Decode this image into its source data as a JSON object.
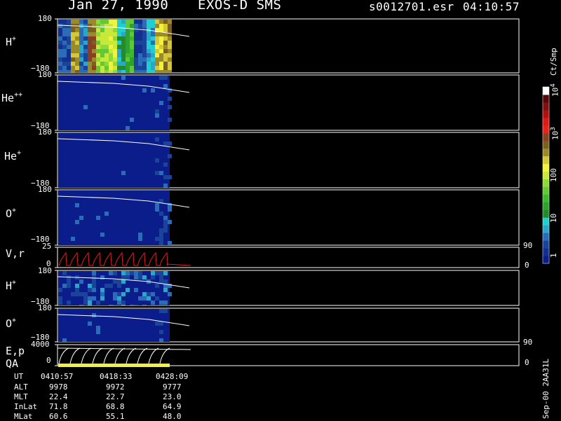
{
  "header": {
    "date": "Jan 27, 1990",
    "instrument": "EXOS-D SMS",
    "file": "s0012701.esr",
    "time": "04:10:57"
  },
  "colorbar": {
    "unit": "Ct/Smp",
    "labels": [
      "1",
      "10",
      "100",
      "10",
      "10"
    ],
    "exponents": [
      "3",
      "4"
    ],
    "colors": [
      "#0a1d8a",
      "#12308f",
      "#1a4499",
      "#2a6cb8",
      "#2aa6c8",
      "#1fcfcf",
      "#238b2a",
      "#2fa12f",
      "#3fb830",
      "#63c835",
      "#8fd83a",
      "#c8e83a",
      "#f2f23a",
      "#d4c83a",
      "#9a8a2a",
      "#7a6020",
      "#8a4020",
      "#e8241a",
      "#e01818",
      "#b01010",
      "#801010",
      "#560808",
      "#ffffff"
    ]
  },
  "panels": [
    {
      "label": "H",
      "charge": "+",
      "ymax": "180",
      "ymin": "−180"
    },
    {
      "label": "He",
      "charge": "++",
      "ymax": "180",
      "ymin": "−180"
    },
    {
      "label": "He",
      "charge": "+",
      "ymax": "180",
      "ymin": "−180"
    },
    {
      "label": "O",
      "charge": "+",
      "ymax": "180",
      "ymin": "−180"
    },
    {
      "label": "V,r",
      "charge": "",
      "ymax": "25",
      "ymin": "0",
      "rmax": "90",
      "rmin": "0"
    },
    {
      "label": "H",
      "charge": "+",
      "ymax": "180",
      "ymin": "−180"
    },
    {
      "label": "O",
      "charge": "+",
      "ymax": "180",
      "ymin": "−180"
    },
    {
      "label": "E,p",
      "charge": "",
      "ymax": "4000",
      "ymin": "0",
      "rmax": "90",
      "rmin": "0"
    }
  ],
  "qa_label": "QA",
  "footer": {
    "rows": [
      {
        "name": "UT",
        "values": [
          "0410:57",
          "0418:33",
          "0428:09"
        ]
      },
      {
        "name": "ALT",
        "values": [
          "9978",
          "9972",
          "9777"
        ]
      },
      {
        "name": "MLT",
        "values": [
          "22.4",
          "22.7",
          "23.0"
        ]
      },
      {
        "name": "InLat",
        "values": [
          "71.8",
          "68.8",
          "64.9"
        ]
      },
      {
        "name": "MLat",
        "values": [
          "60.6",
          "55.1",
          "48.0"
        ]
      }
    ]
  },
  "side_note": "Sep-00 2AA31L",
  "chart_data": {
    "type": "heatmap",
    "title": "Jan 27, 1990   EXOS-D SMS",
    "x_ticks": [
      "0410:57",
      "0418:33",
      "0428:09"
    ],
    "panels": [
      {
        "label": "H+",
        "ylim": [
          -180,
          180
        ],
        "dominant_counts": "10-100",
        "color_levels": [
          2,
          14,
          3,
          15,
          10,
          11,
          5,
          8,
          2,
          4,
          13,
          14
        ]
      },
      {
        "label": "He++",
        "ylim": [
          -180,
          180
        ],
        "dominant_counts": "1"
      },
      {
        "label": "He+",
        "ylim": [
          -180,
          180
        ],
        "dominant_counts": "1"
      },
      {
        "label": "O+",
        "ylim": [
          -180,
          180
        ],
        "dominant_counts": "1"
      },
      {
        "label": "V,r",
        "ylim": [
          0,
          25
        ],
        "right_ylim": [
          0,
          90
        ]
      },
      {
        "label": "H+",
        "ylim": [
          -180,
          180
        ],
        "dominant_counts": "1-10"
      },
      {
        "label": "O+",
        "ylim": [
          -180,
          180
        ],
        "dominant_counts": "1"
      },
      {
        "label": "E,p",
        "ylim": [
          0,
          4000
        ],
        "right_ylim": [
          0,
          90
        ]
      }
    ],
    "colorbar_range": [
      1,
      10000
    ],
    "colorbar_scale": "log"
  }
}
